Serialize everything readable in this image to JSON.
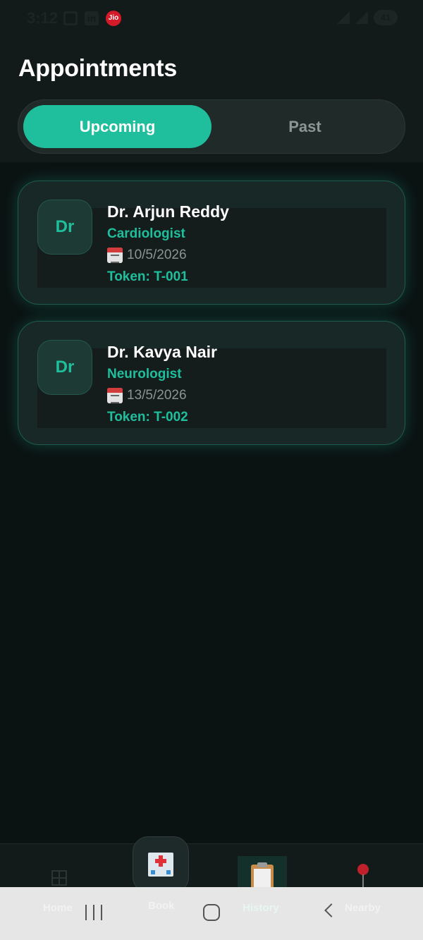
{
  "status_bar": {
    "time": "3:12",
    "carrier_badge": "Jio",
    "linkedin_glyph": "in",
    "battery_level": "41",
    "icons": [
      "screenshot-icon",
      "linkedin-icon",
      "jio-icon",
      "wifi-icon",
      "signal-icon",
      "battery-icon"
    ]
  },
  "header": {
    "title": "Appointments",
    "tabs": [
      {
        "label": "Upcoming",
        "active": true
      },
      {
        "label": "Past",
        "active": false
      }
    ]
  },
  "appointments": [
    {
      "avatar_text": "Dr",
      "name": "Dr. Arjun Reddy",
      "specialty": "Cardiologist",
      "date": "10/5/2026",
      "token": "Token: T-001"
    },
    {
      "avatar_text": "Dr",
      "name": "Dr. Kavya Nair",
      "specialty": "Neurologist",
      "date": "13/5/2026",
      "token": "Token: T-002"
    }
  ],
  "bottom_nav": {
    "items": [
      {
        "label": "Home",
        "icon": "grid-icon",
        "active": false
      },
      {
        "label": "Book",
        "icon": "hospital-icon",
        "active": false
      },
      {
        "label": "History",
        "icon": "clipboard-icon",
        "active": true
      },
      {
        "label": "Nearby",
        "icon": "pushpin-icon",
        "active": false
      }
    ]
  },
  "system_nav": {
    "icons": [
      "recent-apps-icon",
      "home-icon",
      "back-icon"
    ]
  },
  "colors": {
    "accent": "#1fbf9d",
    "background": "#0b1212",
    "surface": "#121b1a",
    "muted_text": "#8a9493"
  }
}
